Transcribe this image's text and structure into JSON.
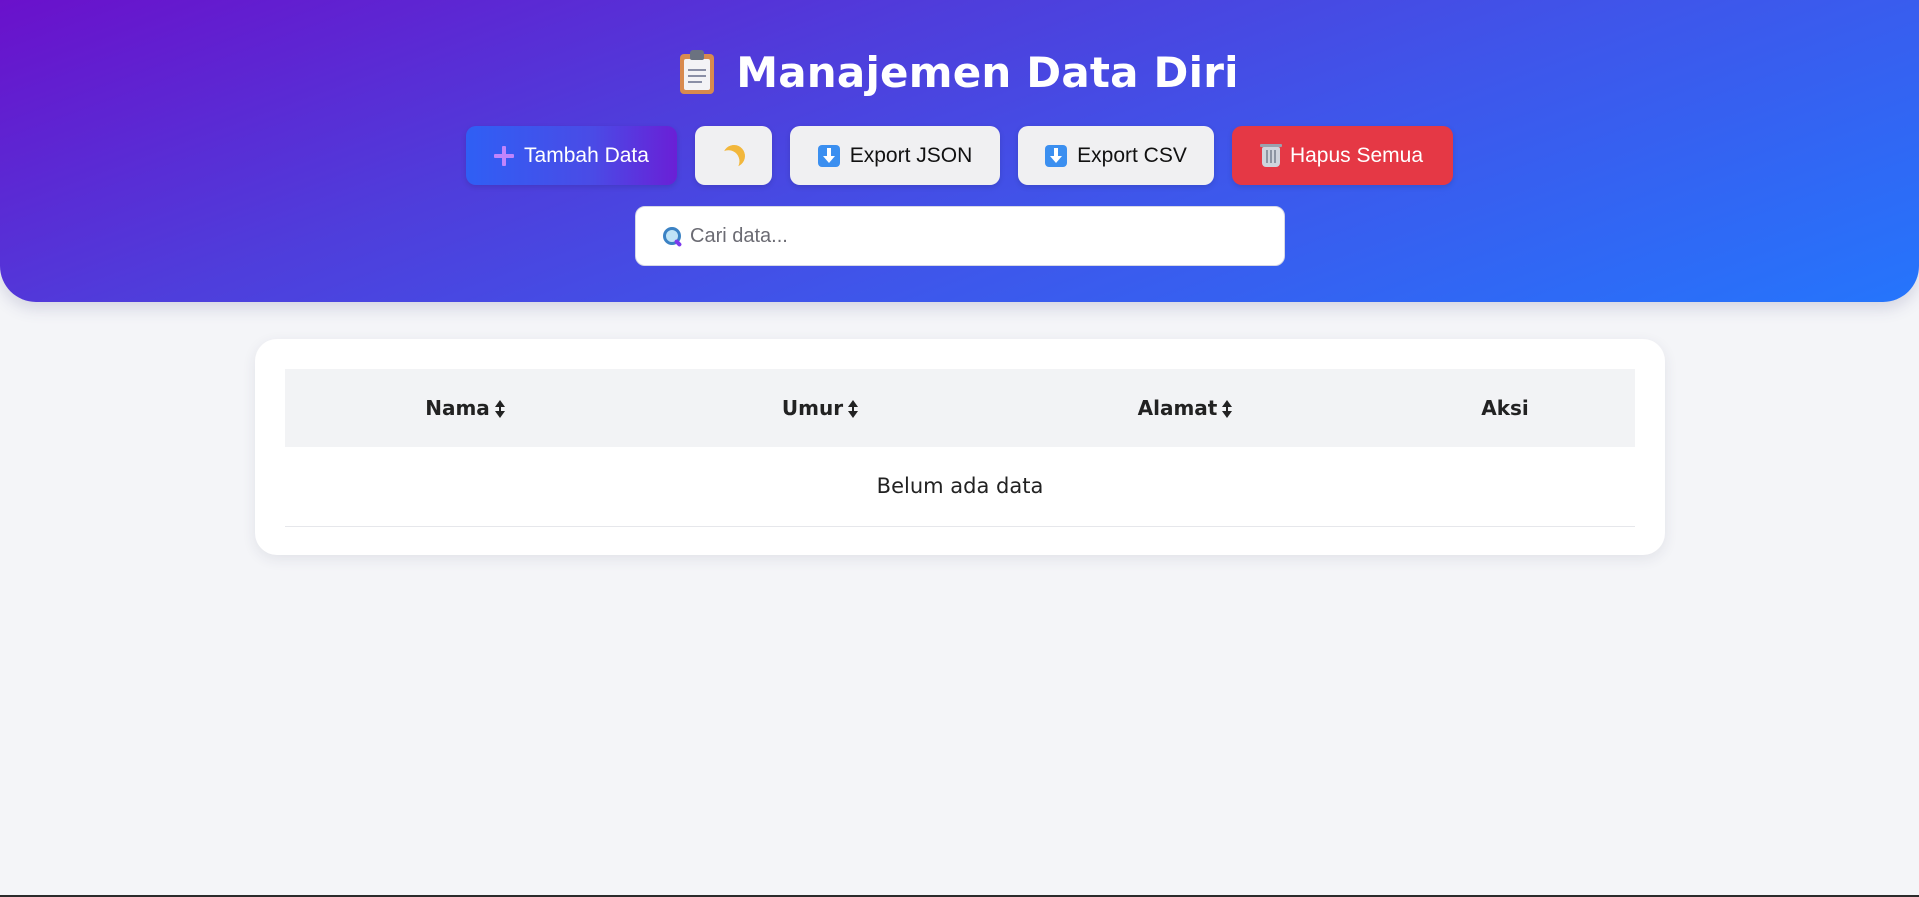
{
  "header": {
    "title": "Manajemen Data Diri",
    "title_icon": "clipboard-icon",
    "gradient_start": "#6a11cb",
    "gradient_end": "#2575fc"
  },
  "toolbar": {
    "add_label": "Tambah Data",
    "add_icon": "plus-icon",
    "theme_icon": "moon-icon",
    "export_json_label": "Export JSON",
    "export_csv_label": "Export CSV",
    "export_icon": "download-icon",
    "delete_all_label": "Hapus Semua",
    "delete_icon": "trash-icon",
    "danger_color": "#e53845"
  },
  "search": {
    "placeholder": "Cari data...",
    "value": "",
    "icon": "search-icon"
  },
  "table": {
    "columns": [
      {
        "label": "Nama",
        "sortable": true
      },
      {
        "label": "Umur",
        "sortable": true
      },
      {
        "label": "Alamat",
        "sortable": true
      },
      {
        "label": "Aksi",
        "sortable": false
      }
    ],
    "rows": [],
    "empty_message": "Belum ada data"
  }
}
